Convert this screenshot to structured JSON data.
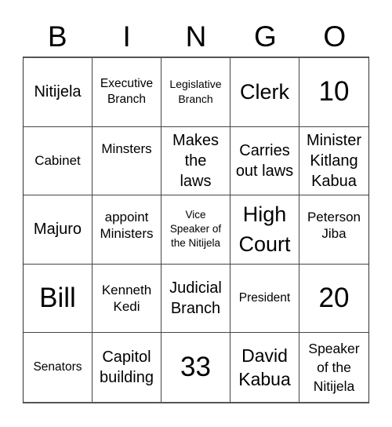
{
  "header": {
    "letters": [
      "B",
      "I",
      "N",
      "G",
      "O"
    ]
  },
  "grid": {
    "rows": [
      [
        "Nitijela",
        "Executive Branch",
        "Legislative Branch",
        "Clerk",
        "10"
      ],
      [
        "Cabinet",
        "Minsters",
        "Makes the laws",
        "Carries out laws",
        "Minister Kitlang Kabua"
      ],
      [
        "Majuro",
        "appoint Ministers",
        "Vice Speaker of the Nitijela",
        "High Court",
        "Peterson Jiba"
      ],
      [
        "Bill",
        "Kenneth Kedi",
        "Judicial Branch",
        "President",
        "20"
      ],
      [
        "Senators",
        "Capitol building",
        "33",
        "David Kabua",
        "Speaker of the Nitijela"
      ]
    ]
  }
}
